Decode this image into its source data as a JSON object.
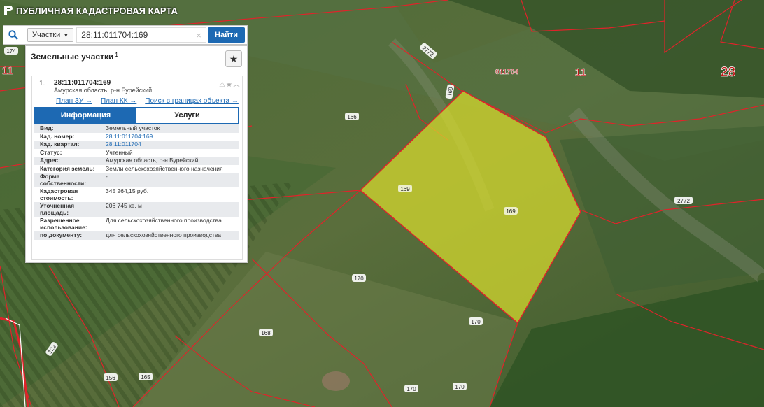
{
  "app": {
    "title": "ПУБЛИЧНАЯ КАДАСТРОВАЯ КАРТА"
  },
  "search": {
    "type_label": "Участки",
    "query": "28:11:011704:169",
    "find_label": "Найти",
    "clear_glyph": "×"
  },
  "panel": {
    "title": "Земельные участки",
    "count": "1",
    "result": {
      "index": "1.",
      "cad_number": "28:11:011704:169",
      "address": "Амурская область, р-н Бурейский",
      "links": {
        "plan_zu": "План ЗУ →",
        "plan_kk": "План КК →",
        "search_in_bounds": "Поиск в границах объекта →"
      },
      "tabs": {
        "info": "Информация",
        "services": "Услуги"
      },
      "rows": [
        {
          "key": "Вид:",
          "value": "Земельный участок"
        },
        {
          "key": "Кад. номер:",
          "value": "28:11:011704:169"
        },
        {
          "key": "Кад. квартал:",
          "value": "28:11:011704"
        },
        {
          "key": "Статус:",
          "value": "Учтенный"
        },
        {
          "key": "Адрес:",
          "value": "Амурская область, р-н Бурейский"
        },
        {
          "key": "Категория земель:",
          "value": "Земли сельскохозяйственного назначения"
        },
        {
          "key": "Форма собственности:",
          "value": "-"
        },
        {
          "key": "Кадастровая стоимость:",
          "value": "345 264,15 руб."
        },
        {
          "key": "Уточненная площадь:",
          "value": "206 745 кв. м"
        },
        {
          "key": "Разрешенное использование:",
          "value": "Для сельскохозяйственного производства"
        },
        {
          "key": "по документу:",
          "value": "для сельскохозяйственного производства"
        }
      ]
    }
  },
  "map": {
    "labels": {
      "l174": "174",
      "l11a": "11",
      "l11b": "11",
      "l28": "28",
      "l011704": "011704",
      "l2772a": "2772",
      "l2772b": "2772",
      "l166": "166",
      "l169a": "169",
      "l169b": "169",
      "l169c": "169",
      "l170a": "170",
      "l170b": "170",
      "l170c": "170",
      "l170d": "170",
      "l168": "168",
      "l156": "156",
      "l165": "165",
      "l122": "122"
    },
    "colors": {
      "parcel_fill": "#d8dc2e",
      "boundary": "#e0232a"
    }
  }
}
